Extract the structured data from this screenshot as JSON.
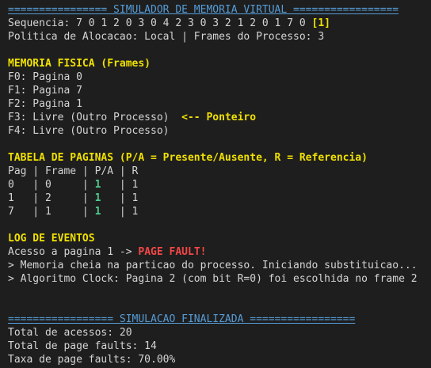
{
  "header_sim": "================ SIMULADOR DE MEMORIA VIRTUAL =================",
  "sequence": {
    "label": "Sequencia: ",
    "values": "7 0 1 2 0 3 0 4 2 3 0 3 2 1 2 0 1 7 0 ",
    "current": "[1]"
  },
  "policy_line": "Politica de Alocacao: Local | Frames do Processo: 3",
  "memory": {
    "title": "MEMORIA FISICA (Frames)",
    "frames": [
      "F0: Pagina 0",
      "F1: Pagina 7",
      "F2: Pagina 1",
      "F3: Livre (Outro Processo)",
      "F4: Livre (Outro Processo)"
    ],
    "pointer_label": "<-- Ponteiro"
  },
  "page_table": {
    "title": "TABELA DE PAGINAS (P/A = Presente/Ausente, R = Referencia)",
    "header_line": "Pag | Frame | P/A | R",
    "rows": [
      {
        "pag": "0   | 0     | ",
        "pa": "1",
        "r": "   | 1"
      },
      {
        "pag": "1   | 2     | ",
        "pa": "1",
        "r": "   | 1"
      },
      {
        "pag": "7   | 1     | ",
        "pa": "1",
        "r": "   | 1"
      }
    ]
  },
  "log": {
    "title": "LOG DE EVENTOS",
    "access_prefix": "Acesso a pagina 1 -> ",
    "access_status": "PAGE FAULT!",
    "messages": [
      "> Memoria cheia na particao do processo. Iniciando substituicao...",
      "> Algoritmo Clock: Pagina 2 (com bit R=0) foi escolhida no frame 2"
    ]
  },
  "header_end": "================= SIMULACAO FINALIZADA =================",
  "stats": [
    "Total de acessos: 20",
    "Total de page faults: 14",
    "Taxa de page faults: 70.00%"
  ]
}
